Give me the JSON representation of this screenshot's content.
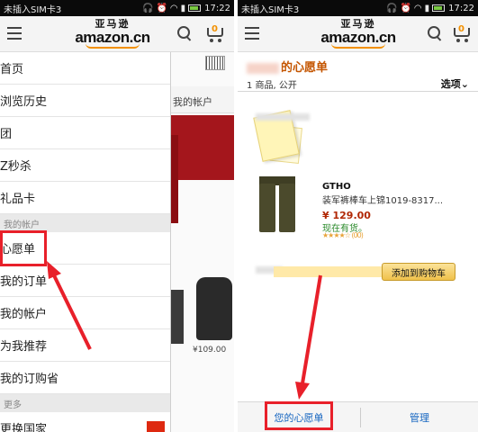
{
  "left": {
    "status": {
      "carrier": "未插入SIM卡3",
      "time": "17:22"
    },
    "logo": {
      "cn": "亚马逊",
      "word": "amazon.cn"
    },
    "cart_count": "0",
    "behind": {
      "menu_text": "我的帐户",
      "price": "¥109.00"
    },
    "drawer": {
      "items": [
        "首页",
        "浏览历史",
        "团",
        "Z秒杀",
        "礼品卡"
      ],
      "section_account": "我的帐户",
      "account_items": [
        "心愿单",
        "我的订单",
        "我的帐户",
        "为我推荐",
        "我的订购省"
      ],
      "section_more": "更多",
      "more_items": [
        "更换国家"
      ]
    }
  },
  "right": {
    "status": {
      "carrier": "未插入SIM卡3",
      "time": "17:22"
    },
    "logo": {
      "cn": "亚马逊",
      "word": "amazon.cn"
    },
    "cart_count": "0",
    "wishlist": {
      "title": "的心愿单",
      "count_label": "1 商品, 公开",
      "options_label": "选项"
    },
    "product": {
      "brand": "GTHO",
      "name": "装军裤棒车上锦1019-8317...",
      "price": "¥ 129.00",
      "stock": "现在有货。",
      "rating_text": "★★★★☆ (00)"
    },
    "add_to_cart": "添加到购物车",
    "bottom": {
      "left_tab": "您的心愿单",
      "right_tab": "管理"
    }
  },
  "colors": {
    "highlight": "#e8202a",
    "amazon_orange": "#f29000",
    "link_blue": "#1565c0"
  }
}
